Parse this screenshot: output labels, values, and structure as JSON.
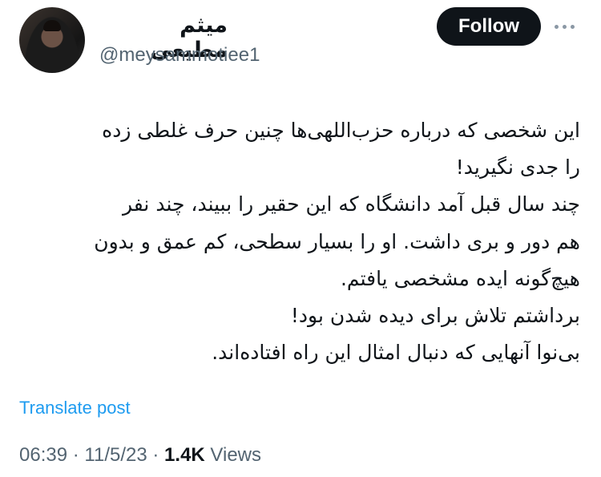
{
  "author": {
    "display_name": "میثم مطیعی",
    "handle": "@meysammotiee1",
    "follow_label": "Follow",
    "more_icon": "more-horizontal-icon"
  },
  "tweet": {
    "lines": [
      "این شخصی که درباره حزب‌اللهی‌ها چنین حرف غلطی زده",
      "را جدی نگیرید!",
      "چند سال قبل آمد دانشگاه که این حقیر را ببیند، چند نفر",
      "هم دور و بری داشت. او را بسیار سطحی، کم عمق و بدون",
      "هیچ‌گونه ایده مشخصی یافتم.",
      "برداشتم تلاش برای دیده شدن بود!",
      "بی‌نوا آنهایی که دنبال امثال این راه افتاده‌اند."
    ],
    "translate_label": "Translate post",
    "time": "06:39",
    "date": "11/5/23",
    "views_count": "1.4K",
    "views_label": "Views",
    "separator": "·"
  },
  "colors": {
    "accent": "#1d9bf0",
    "text": "#0f1419",
    "muted": "#536471"
  }
}
